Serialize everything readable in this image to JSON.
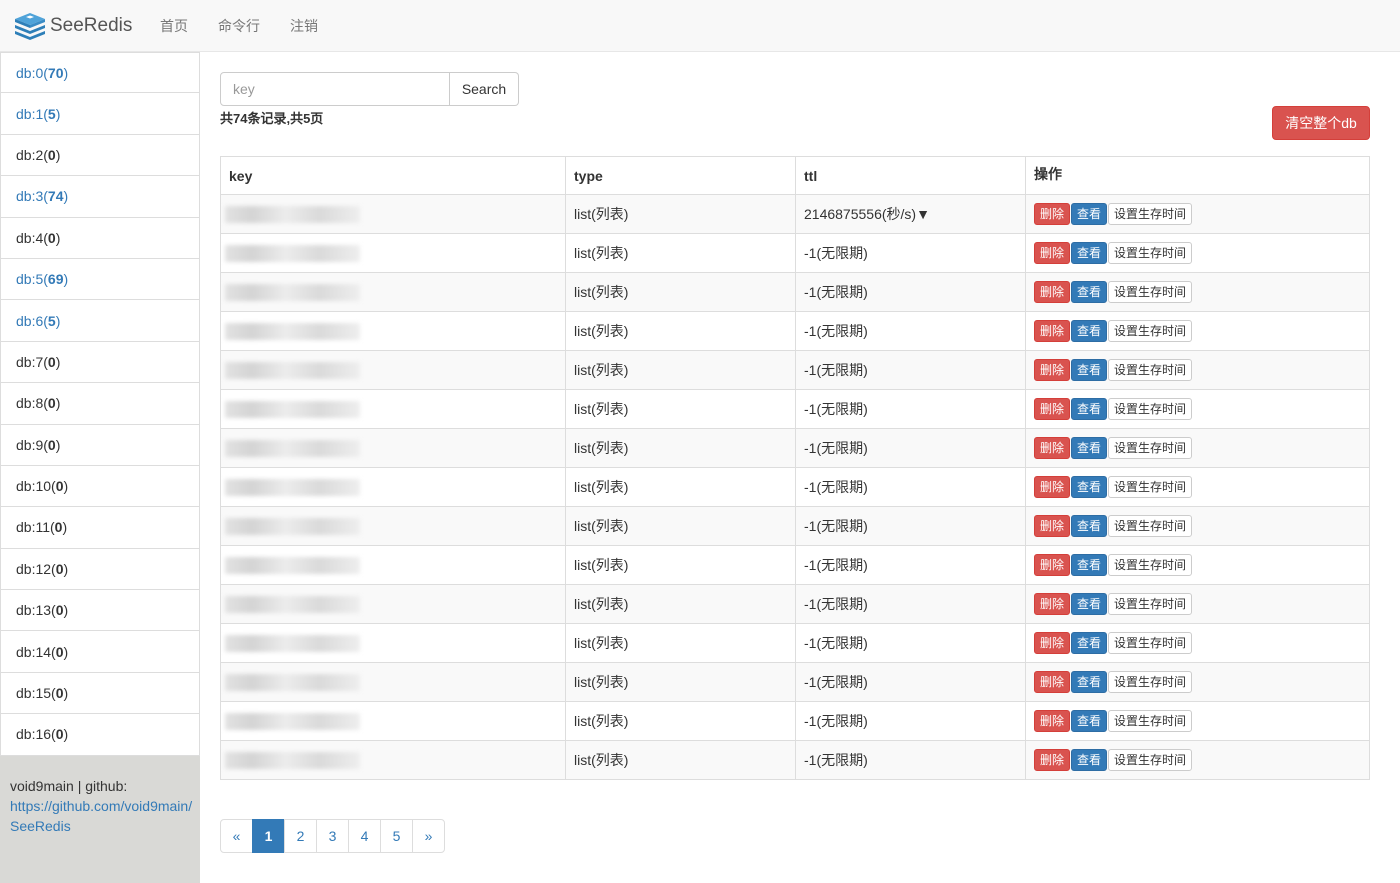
{
  "navbar": {
    "brand": "SeeRedis",
    "links": [
      "首页",
      "命令行",
      "注销"
    ]
  },
  "sidebar": {
    "dbs": [
      {
        "name": "db:0",
        "count": "70",
        "active": true
      },
      {
        "name": "db:1",
        "count": "5",
        "active": true
      },
      {
        "name": "db:2",
        "count": "0",
        "active": false
      },
      {
        "name": "db:3",
        "count": "74",
        "active": true
      },
      {
        "name": "db:4",
        "count": "0",
        "active": false
      },
      {
        "name": "db:5",
        "count": "69",
        "active": true
      },
      {
        "name": "db:6",
        "count": "5",
        "active": true
      },
      {
        "name": "db:7",
        "count": "0",
        "active": false
      },
      {
        "name": "db:8",
        "count": "0",
        "active": false
      },
      {
        "name": "db:9",
        "count": "0",
        "active": false
      },
      {
        "name": "db:10",
        "count": "0",
        "active": false
      },
      {
        "name": "db:11",
        "count": "0",
        "active": false
      },
      {
        "name": "db:12",
        "count": "0",
        "active": false
      },
      {
        "name": "db:13",
        "count": "0",
        "active": false
      },
      {
        "name": "db:14",
        "count": "0",
        "active": false
      },
      {
        "name": "db:15",
        "count": "0",
        "active": false
      },
      {
        "name": "db:16",
        "count": "0",
        "active": false
      }
    ],
    "footer": {
      "text": "void9main | github:",
      "link": "https://github.com/void9main/SeeRedis"
    }
  },
  "search": {
    "placeholder": "key",
    "value": "",
    "button": "Search"
  },
  "summary": "共74条记录,共5页",
  "clear_button": "清空整个db",
  "table": {
    "headers": [
      "key",
      "type",
      "ttl",
      "操作"
    ],
    "rows": [
      {
        "type": "list(列表)",
        "ttl": "2146875556(秒/s)▼"
      },
      {
        "type": "list(列表)",
        "ttl": "-1(无限期)"
      },
      {
        "type": "list(列表)",
        "ttl": "-1(无限期)"
      },
      {
        "type": "list(列表)",
        "ttl": "-1(无限期)"
      },
      {
        "type": "list(列表)",
        "ttl": "-1(无限期)"
      },
      {
        "type": "list(列表)",
        "ttl": "-1(无限期)"
      },
      {
        "type": "list(列表)",
        "ttl": "-1(无限期)"
      },
      {
        "type": "list(列表)",
        "ttl": "-1(无限期)"
      },
      {
        "type": "list(列表)",
        "ttl": "-1(无限期)"
      },
      {
        "type": "list(列表)",
        "ttl": "-1(无限期)"
      },
      {
        "type": "list(列表)",
        "ttl": "-1(无限期)"
      },
      {
        "type": "list(列表)",
        "ttl": "-1(无限期)"
      },
      {
        "type": "list(列表)",
        "ttl": "-1(无限期)"
      },
      {
        "type": "list(列表)",
        "ttl": "-1(无限期)"
      },
      {
        "type": "list(列表)",
        "ttl": "-1(无限期)"
      }
    ],
    "actions": {
      "delete": "删除",
      "view": "查看",
      "set_ttl": "设置生存时间"
    }
  },
  "pagination": {
    "prev": "«",
    "pages": [
      "1",
      "2",
      "3",
      "4",
      "5"
    ],
    "current": "1",
    "next": "»"
  },
  "colors": {
    "primary": "#337ab7",
    "danger": "#d9534f",
    "sidebar_bg": "#d9d9d6"
  }
}
